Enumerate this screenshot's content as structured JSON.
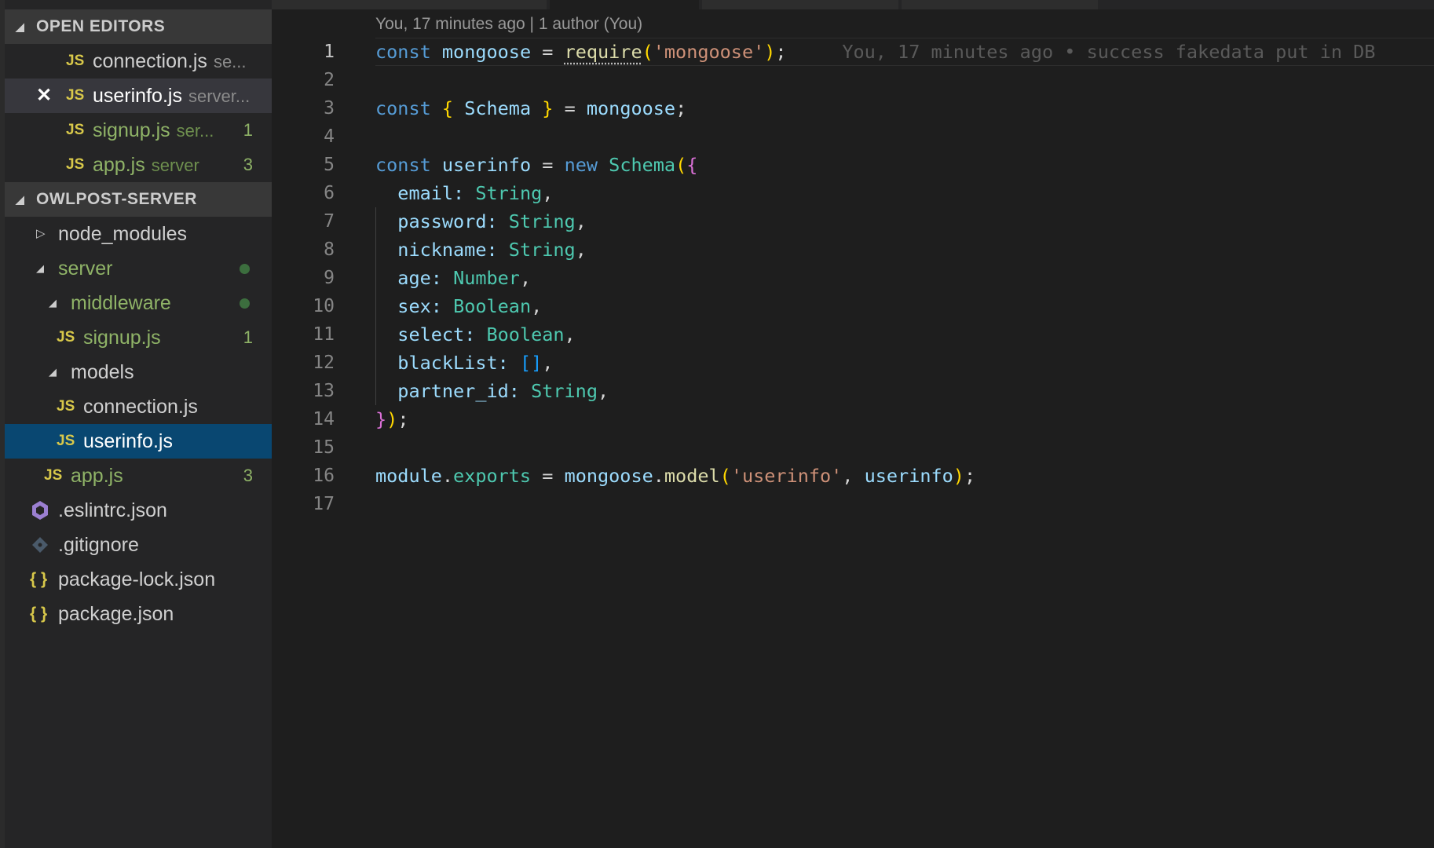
{
  "sidebar": {
    "open_editors": {
      "header": "OPEN EDITORS",
      "items": [
        {
          "icon": "JS",
          "name": "connection.js",
          "desc": "se...",
          "badge": ""
        },
        {
          "icon": "JS",
          "name": "userinfo.js",
          "desc": "server...",
          "badge": "",
          "close": "✕"
        },
        {
          "icon": "JS",
          "name": "signup.js",
          "desc": "ser...",
          "badge": "1"
        },
        {
          "icon": "JS",
          "name": "app.js",
          "desc": "server",
          "badge": "3"
        }
      ]
    },
    "explorer": {
      "header": "OWLPOST-SERVER",
      "items": [
        {
          "name": "node_modules"
        },
        {
          "name": "server"
        },
        {
          "name": "middleware"
        },
        {
          "icon": "JS",
          "name": "signup.js",
          "badge": "1"
        },
        {
          "name": "models"
        },
        {
          "icon": "JS",
          "name": "connection.js"
        },
        {
          "icon": "JS",
          "name": "userinfo.js"
        },
        {
          "icon": "JS",
          "name": "app.js",
          "badge": "3"
        },
        {
          "icon": "eslint-icon",
          "name": ".eslintrc.json"
        },
        {
          "icon": "git-icon",
          "name": ".gitignore"
        },
        {
          "icon": "{ }",
          "name": "package-lock.json"
        },
        {
          "icon": "{ }",
          "name": "package.json"
        }
      ]
    }
  },
  "editor": {
    "codelens": "You, 17 minutes ago | 1 author (You)",
    "blame": "You, 17 minutes ago • success fakedata put in DB",
    "line_numbers": [
      "1",
      "2",
      "3",
      "4",
      "5",
      "6",
      "7",
      "8",
      "9",
      "10",
      "11",
      "12",
      "13",
      "14",
      "15",
      "16",
      "17"
    ],
    "code": {
      "l1": {
        "kw": "const",
        "var": "mongoose",
        "eq": "=",
        "fn": "require",
        "str": "'mongoose'",
        "end": ";"
      },
      "l3": {
        "kw": "const",
        "var": "Schema",
        "eq": "=",
        "rhs": "mongoose",
        "end": ";"
      },
      "l5": {
        "kw": "const",
        "var": "userinfo",
        "eq": "=",
        "kw2": "new",
        "type": "Schema"
      },
      "fields": [
        {
          "key": "email",
          "type": "String"
        },
        {
          "key": "password",
          "type": "String"
        },
        {
          "key": "nickname",
          "type": "String"
        },
        {
          "key": "age",
          "type": "Number"
        },
        {
          "key": "sex",
          "type": "Boolean"
        },
        {
          "key": "select",
          "type": "Boolean"
        },
        {
          "key": "blackList",
          "type": "[]"
        },
        {
          "key": "partner_id",
          "type": "String"
        }
      ],
      "l16": {
        "obj": "module",
        "prop": "exports",
        "eq": "=",
        "var": "mongoose",
        "fn": "model",
        "str": "'userinfo'",
        "arg": "userinfo",
        "end": ";"
      }
    }
  },
  "colors": {
    "background": "#1e1e1e",
    "sidebar": "#252526",
    "selection": "#094771",
    "git_modified": "#8fb367",
    "js_icon": "#d8c84a"
  }
}
